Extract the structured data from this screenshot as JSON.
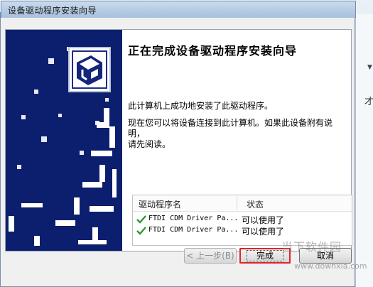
{
  "window": {
    "title": "设备驱动程序安装向导"
  },
  "content": {
    "heading": "正在完成设备驱动程序安装向导",
    "message1": "此计算机上成功地安装了此驱动程序。",
    "message2_line1": "现在您可以将设备连接到此计算机。如果此设备附有说明，",
    "message2_line2": "请先阅读。"
  },
  "driver_table": {
    "columns": [
      "驱动程序名",
      "状态"
    ],
    "rows": [
      {
        "name": "FTDI CDM Driver Pa...",
        "status": "可以使用了"
      },
      {
        "name": "FTDI CDM Driver Pa...",
        "status": "可以使用了"
      }
    ]
  },
  "buttons": {
    "back": "< 上一步(B)",
    "finish": "完成",
    "cancel": "取消"
  },
  "watermark": {
    "logo": "当下软件园",
    "url": "www.downxia.com"
  },
  "background": {
    "partial_char": "才"
  },
  "colors": {
    "banner": "#0c1e6e",
    "check": "#2e9a2e",
    "highlight": "#e0242c"
  }
}
